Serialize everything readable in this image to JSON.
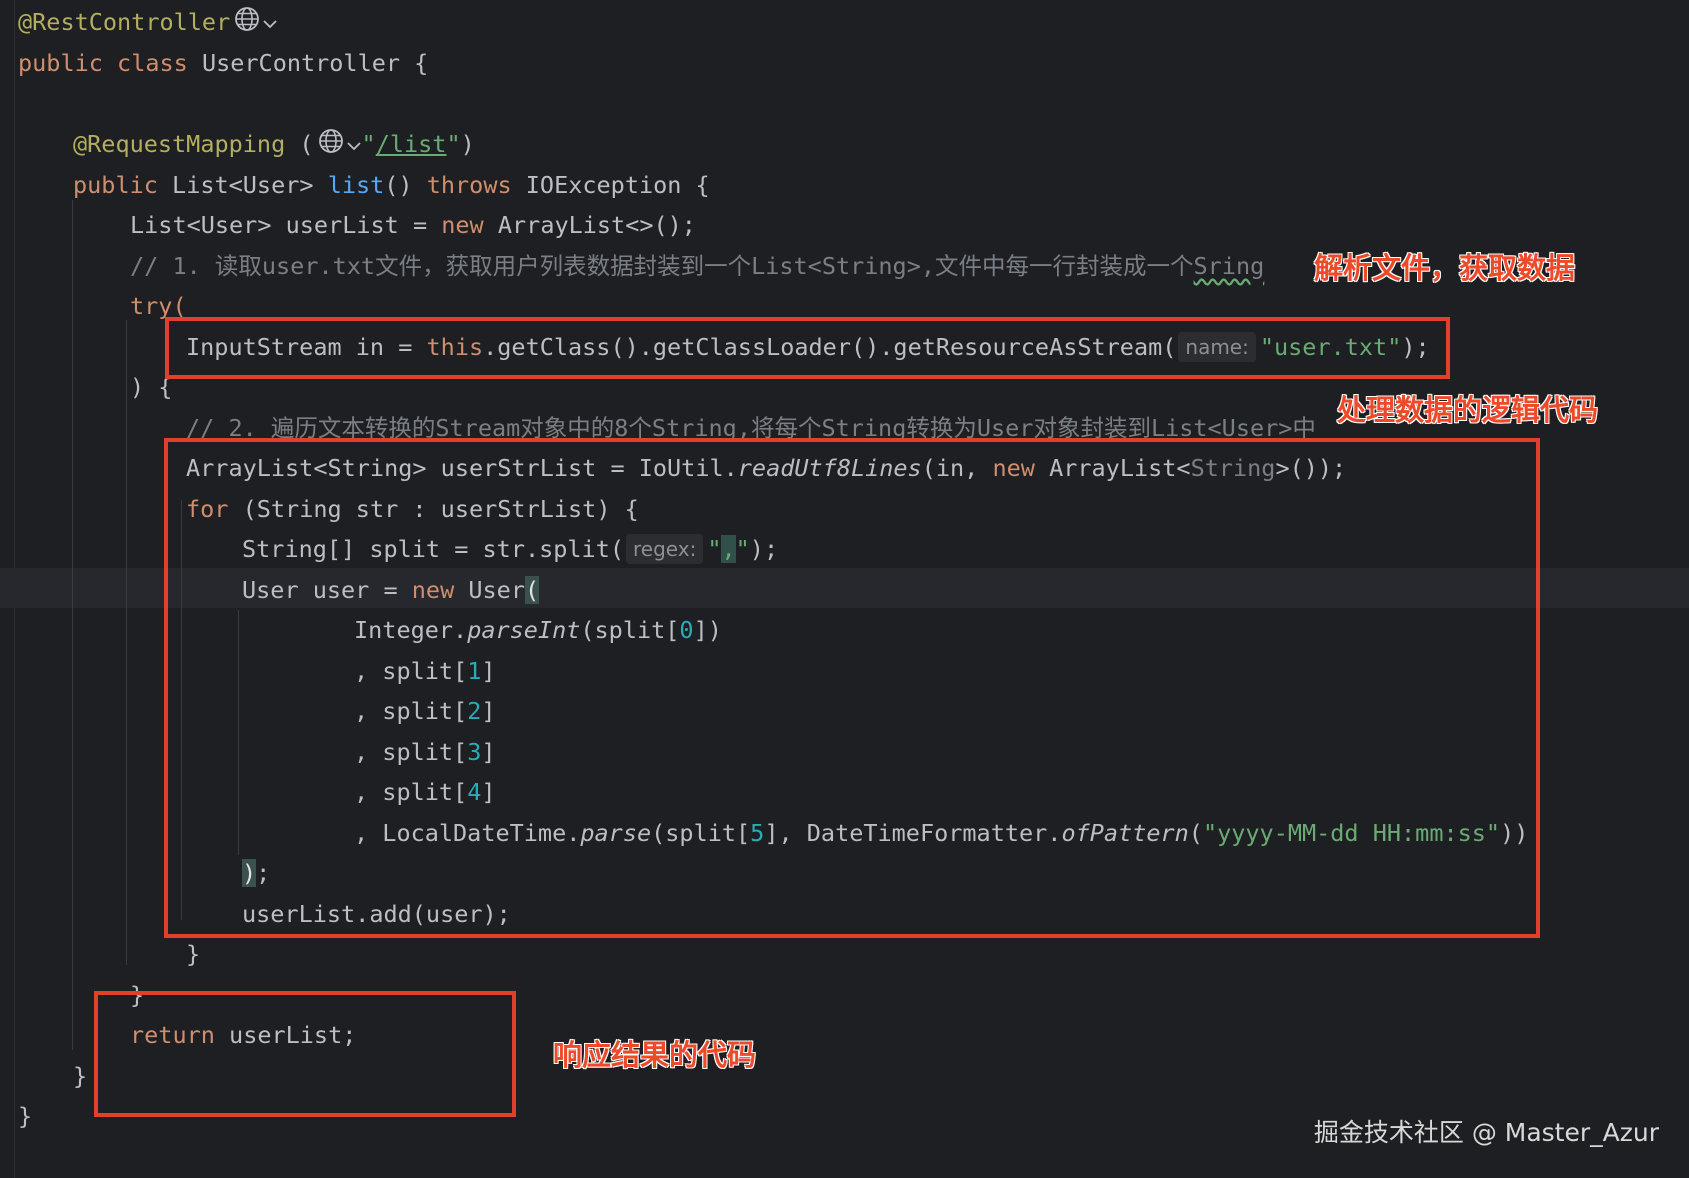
{
  "code": {
    "line1": {
      "annotation": "@RestController"
    },
    "line2": {
      "kw_public": "public",
      "kw_class": "class",
      "class_name": "UserController {"
    },
    "line3": {
      "annotation": "@RequestMapping",
      "paren_open": "(",
      "path_open": "\"",
      "path": "/list",
      "path_close": "\"",
      "paren_close": ")"
    },
    "line4": {
      "kw_public": "public",
      "ret_type": "List<User>",
      "method": "list",
      "params": "()",
      "kw_throws": "throws",
      "rest": "IOException {"
    },
    "line5": {
      "part1": "List<User> userList = ",
      "kw_new": "new",
      "part2": "ArrayList<>();"
    },
    "line6": {
      "comment": "// 1. 读取user.txt文件，获取用户列表数据封装到一个List<String>,文件中每一行封装成一个",
      "comment_tail": "Sring"
    },
    "line7": {
      "kw_try": "try("
    },
    "line8": {
      "part1": "InputStream in = ",
      "kw_this": "this",
      "part2": ".getClass().getClassLoader().getResourceAsStream(",
      "hint": "name:",
      "str": "\"user.txt\"",
      "part3": ");"
    },
    "line9": {
      "text": ") {"
    },
    "line10": {
      "comment": "// 2. 遍历文本转换的Stream对象中的8个String,将每个String转换为User对象封装到List<User>中"
    },
    "line11": {
      "part1": "ArrayList<String> userStrList = IoUtil.",
      "method": "readUtf8Lines",
      "part2": "(in, ",
      "kw_new": "new",
      "part3": "ArrayList<",
      "type_dim": "String",
      "part4": ">());"
    },
    "line12": {
      "kw_for": "for",
      "rest": "(String str : userStrList) {"
    },
    "line13": {
      "part1": "String[] split = str.split(",
      "hint": "regex:",
      "str_open": "\"",
      "str_mid": ",",
      "str_close": "\"",
      "part2": ");"
    },
    "line14": {
      "part1": "User user = ",
      "kw_new": "new",
      "part2": "User",
      "paren": "("
    },
    "line15": {
      "part1": "Integer.",
      "method": "parseInt",
      "part2": "(split[",
      "num": "0",
      "part3": "])"
    },
    "line16": {
      "part1": ", split[",
      "num": "1",
      "part2": "]"
    },
    "line17": {
      "part1": ", split[",
      "num": "2",
      "part2": "]"
    },
    "line18": {
      "part1": ", split[",
      "num": "3",
      "part2": "]"
    },
    "line19": {
      "part1": ", split[",
      "num": "4",
      "part2": "]"
    },
    "line20": {
      "part1": ", LocalDateTime.",
      "method": "parse",
      "part2": "(split[",
      "num": "5",
      "part3": "], DateTimeFormatter.",
      "method2": "ofPattern",
      "part4": "(",
      "str": "\"yyyy-MM-dd HH:mm:ss\"",
      "part5": "))"
    },
    "line21": {
      "paren": ")",
      "semi": ";"
    },
    "line22": {
      "text": "userList.add(user);"
    },
    "line23": {
      "text": "}"
    },
    "line24": {
      "text": "}"
    },
    "line25": {
      "kw_return": "return",
      "rest": "userList;"
    },
    "line26": {
      "text": "}"
    },
    "line27": {
      "text": "}"
    }
  },
  "labels": {
    "parse": "解析文件，获取数据",
    "logic": "处理数据的逻辑代码",
    "response": "响应结果的代码"
  },
  "watermark": "掘金技术社区 @ Master_Azur",
  "icons": {
    "inlay": "globe-icon",
    "dropdown": "chevron-down-icon"
  },
  "colors": {
    "background": "#1e1f22",
    "keyword": "#cf8e6d",
    "annotation": "#b3ae60",
    "string": "#6aab73",
    "number": "#2aacb8",
    "comment": "#7a7e85",
    "highlight_box": "#e0402c"
  }
}
